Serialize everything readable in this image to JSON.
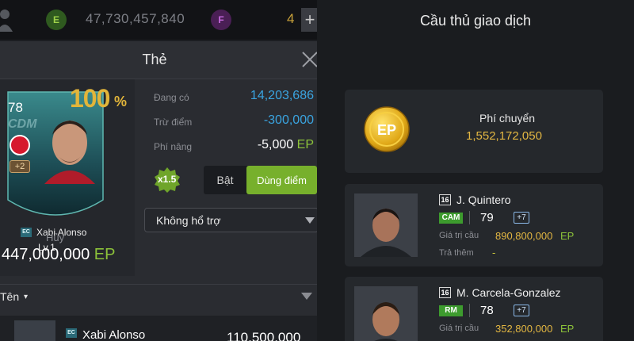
{
  "left": {
    "topbar": {
      "e_icon_letter": "E",
      "coins": "47,730,457,840",
      "f_icon_letter": "F",
      "f_count": "4",
      "plus": "+"
    },
    "dialog": {
      "title": "Thẻ",
      "card": {
        "rating": "78",
        "position": "CDM",
        "upgrade": "+2",
        "ec_badge": "EC",
        "name": "Xabi Alonso",
        "level": "Lv.1",
        "percent": "100",
        "percent_sign": "%"
      },
      "cancel_label": "Hủy",
      "card_price": "447,000,000",
      "card_price_unit": "EP",
      "stats": {
        "owned_label": "Đang có",
        "owned_value": "14,203,686",
        "deduct_label": "Trừ điểm",
        "deduct_value": "-300,000",
        "fee_label": "Phí nâng",
        "fee_value": "-5,000",
        "fee_unit": "EP"
      },
      "multiplier": "x1.5",
      "toggle_on": "Bật",
      "toggle_points": "Dùng điểm",
      "support_select": "Không hổ trợ",
      "sort_label": "Tên",
      "sort_caret": "▾",
      "list_row": {
        "ec_badge": "EC",
        "name": "Xabi Alonso",
        "price": "110,500,000"
      }
    }
  },
  "right": {
    "title": "Cầu thủ giao dịch",
    "coin_label": "EP",
    "fee_title": "Phí chuyển",
    "fee_amount": "1,552,172,050",
    "players": [
      {
        "season": "16",
        "name": "J. Quintero",
        "position": "CAM",
        "rating": "79",
        "plus": "+7",
        "value_label": "Giá trị cầu",
        "value": "890,800,000",
        "value_unit": "EP",
        "extra_label": "Trả thêm",
        "extra_value": "-"
      },
      {
        "season": "16",
        "name": "M. Carcela-Gonzalez",
        "position": "RM",
        "rating": "78",
        "plus": "+7",
        "value_label": "Giá trị cầu",
        "value": "352,800,000",
        "value_unit": "EP"
      }
    ]
  },
  "colors": {
    "accent_green": "#77b02c",
    "ep_green": "#8cc23a",
    "gold": "#e3b742",
    "blue_value": "#3aa4e0"
  },
  "icons": [
    "user-icon",
    "e-currency-icon",
    "f-currency-icon",
    "plus-icon",
    "close-icon",
    "club-badge-icon",
    "multiplier-badge-icon",
    "dropdown-arrow-icon",
    "ep-coin-icon"
  ]
}
